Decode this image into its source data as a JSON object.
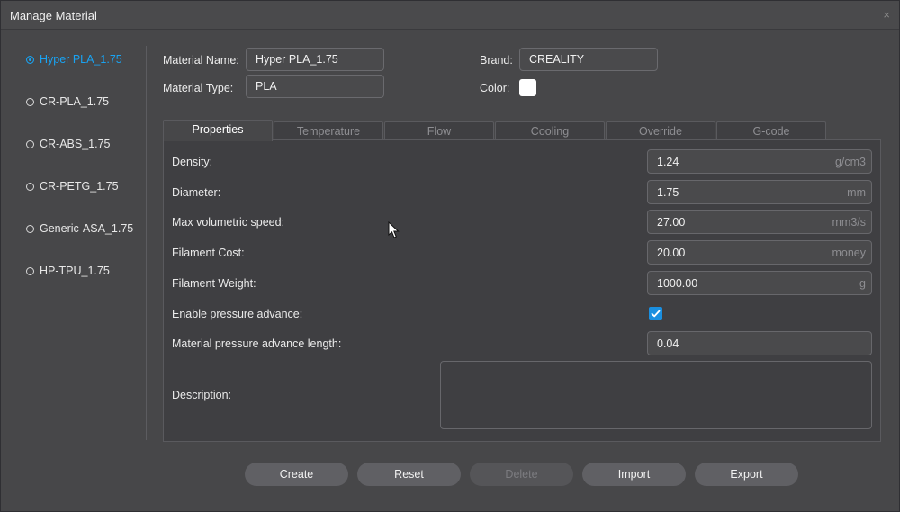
{
  "window": {
    "title": "Manage Material",
    "close_glyph": "×"
  },
  "materials": [
    {
      "label": "Hyper PLA_1.75",
      "selected": true
    },
    {
      "label": "CR-PLA_1.75",
      "selected": false
    },
    {
      "label": "CR-ABS_1.75",
      "selected": false
    },
    {
      "label": "CR-PETG_1.75",
      "selected": false
    },
    {
      "label": "Generic-ASA_1.75",
      "selected": false
    },
    {
      "label": "HP-TPU_1.75",
      "selected": false
    }
  ],
  "header": {
    "material_name_label": "Material Name:",
    "material_name_value": "Hyper PLA_1.75",
    "material_type_label": "Material Type:",
    "material_type_value": "PLA",
    "brand_label": "Brand:",
    "brand_value": "CREALITY",
    "color_label": "Color:",
    "color_value": "#ffffff"
  },
  "tabs": [
    {
      "label": "Properties",
      "active": true
    },
    {
      "label": "Temperature",
      "active": false
    },
    {
      "label": "Flow",
      "active": false
    },
    {
      "label": "Cooling",
      "active": false
    },
    {
      "label": "Override",
      "active": false
    },
    {
      "label": "G-code",
      "active": false
    }
  ],
  "properties": {
    "density": {
      "label": "Density:",
      "value": "1.24",
      "unit": "g/cm3"
    },
    "diameter": {
      "label": "Diameter:",
      "value": "1.75",
      "unit": "mm"
    },
    "max_volumetric_speed": {
      "label": "Max volumetric speed:",
      "value": "27.00",
      "unit": "mm3/s"
    },
    "filament_cost": {
      "label": "Filament Cost:",
      "value": "20.00",
      "unit": "money"
    },
    "filament_weight": {
      "label": "Filament Weight:",
      "value": "1000.00",
      "unit": "g"
    },
    "enable_pressure_advance": {
      "label": "Enable pressure advance:",
      "checked": true
    },
    "pressure_advance_length": {
      "label": "Material pressure advance length:",
      "value": "0.04"
    },
    "description": {
      "label": "Description:",
      "value": ""
    }
  },
  "buttons": {
    "create": "Create",
    "reset": "Reset",
    "delete": "Delete",
    "import": "Import",
    "export": "Export"
  },
  "colors": {
    "accent": "#19a3f2",
    "checkbox": "#1a8fe0",
    "background": "#474749",
    "panel": "#3f3f42"
  }
}
